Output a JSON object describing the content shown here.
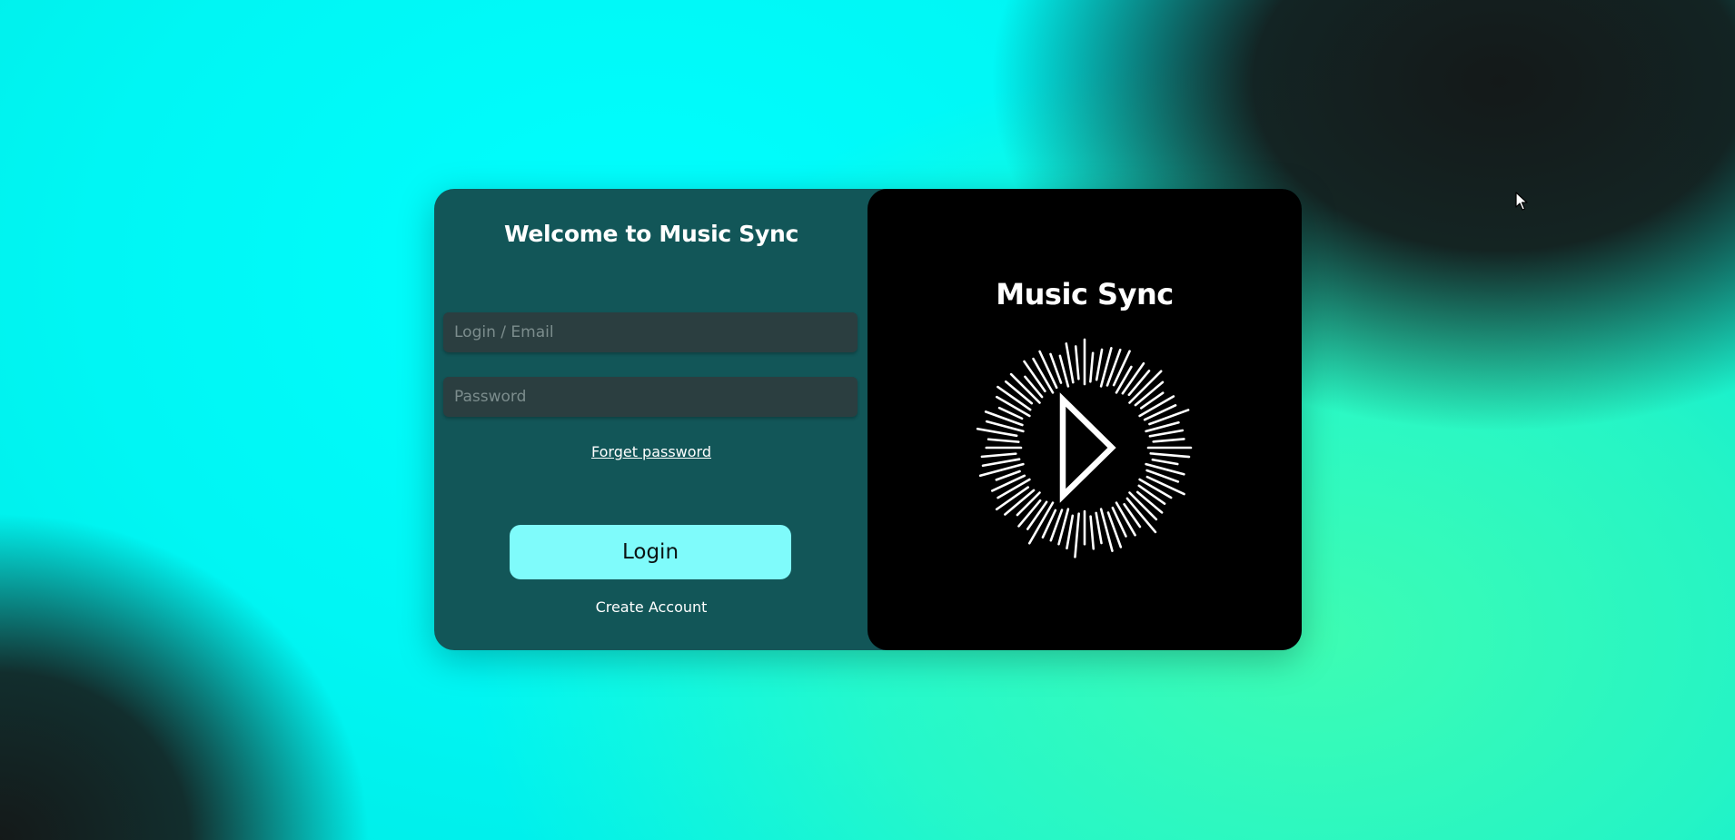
{
  "welcome_title": "Welcome to Music Sync",
  "form": {
    "login_placeholder": "Login / Email",
    "password_placeholder": "Password",
    "forget_password_label": "Forget password",
    "login_button_label": "Login",
    "create_account_label": "Create Account"
  },
  "brand": {
    "title": "Music Sync",
    "logo_icon": "play-burst-icon"
  },
  "colors": {
    "card_left_bg": "#125658",
    "card_right_bg": "#000000",
    "login_button_bg": "#7ffbfb",
    "input_bg": "#2b3e40",
    "background_cyan": "#00ffff",
    "background_mint": "#3dfcb3"
  }
}
